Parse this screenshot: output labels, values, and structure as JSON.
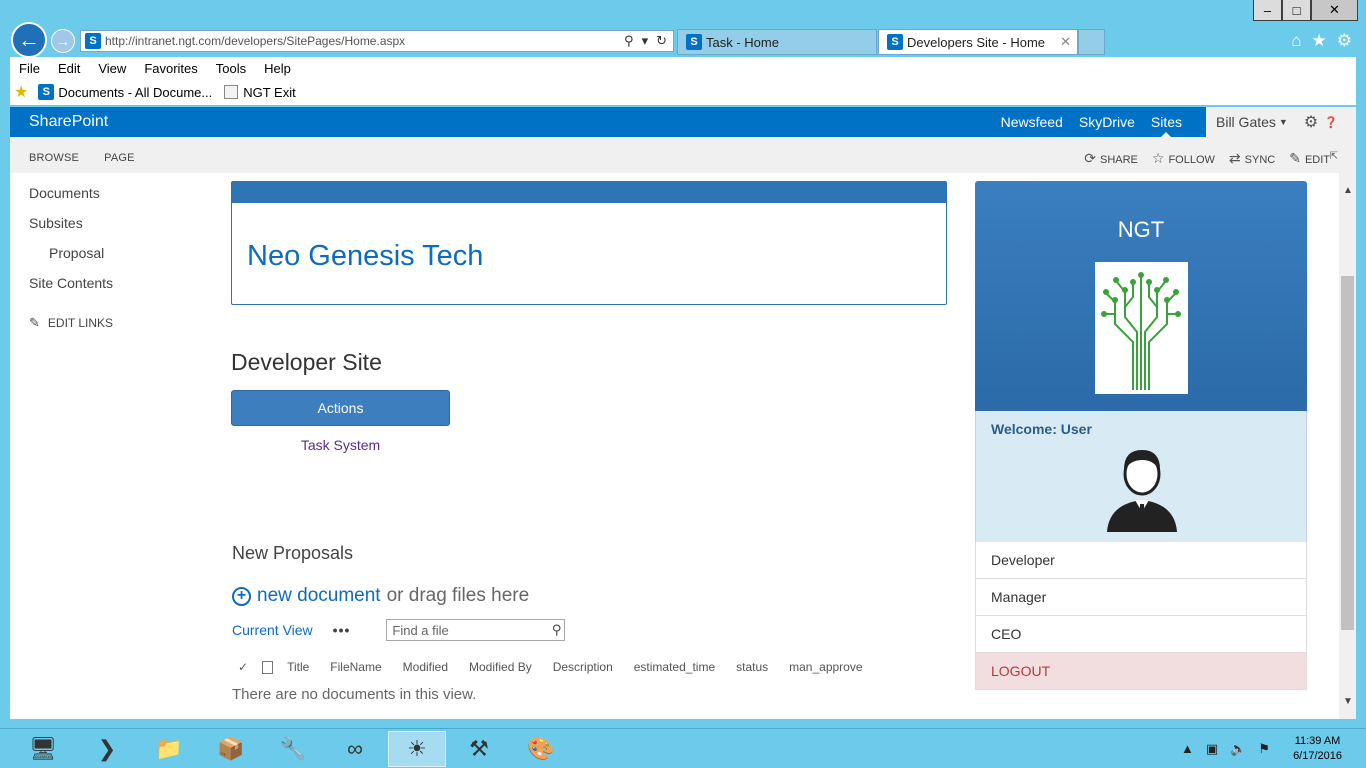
{
  "browser": {
    "address": "http://intranet.ngt.com/developers/SitePages/Home.aspx",
    "tabs": [
      {
        "label": "Task - Home"
      },
      {
        "label": "Developers Site - Home"
      }
    ],
    "menu": [
      "File",
      "Edit",
      "View",
      "Favorites",
      "Tools",
      "Help"
    ],
    "favorites": [
      {
        "label": "Documents - All Docume..."
      },
      {
        "label": "NGT Exit"
      }
    ]
  },
  "suite": {
    "brand": "SharePoint",
    "links": [
      "Newsfeed",
      "SkyDrive",
      "Sites"
    ],
    "user": "Bill Gates"
  },
  "ribbon": {
    "tabs": [
      "BROWSE",
      "PAGE"
    ],
    "actions": [
      "SHARE",
      "FOLLOW",
      "SYNC",
      "EDIT"
    ]
  },
  "quicklaunch": {
    "items": [
      "Documents",
      "Subsites",
      "Proposal",
      "Site Contents"
    ],
    "edit_links": "EDIT LINKS"
  },
  "main": {
    "banner_title": "Neo Genesis Tech",
    "dev_title": "Developer Site",
    "actions_label": "Actions",
    "task_link": "Task System",
    "np_title": "New Proposals",
    "new_document": "new document",
    "drag_text": "or drag files here",
    "current_view": "Current View",
    "ellipsis": "•••",
    "find_placeholder": "Find a file",
    "columns": [
      "Title",
      "FileName",
      "Modified",
      "Modified By",
      "Description",
      "estimated_time",
      "status",
      "man_approve"
    ],
    "empty_msg": "There are no documents in this view."
  },
  "panel": {
    "org": "NGT",
    "welcome": "Welcome: User",
    "items": [
      "Developer",
      "Manager",
      "CEO"
    ],
    "logout": "LOGOUT"
  },
  "taskbar": {
    "time": "11:39 AM",
    "date": "6/17/2016"
  },
  "colors": {
    "suite_blue": "#0072c6",
    "banner_blue": "#2e75b6",
    "panel_blue": "#3a7fc0",
    "welcome_bg": "#d8ebf5",
    "logout_bg": "#f2dede",
    "taskbar": "#6ccbea"
  }
}
